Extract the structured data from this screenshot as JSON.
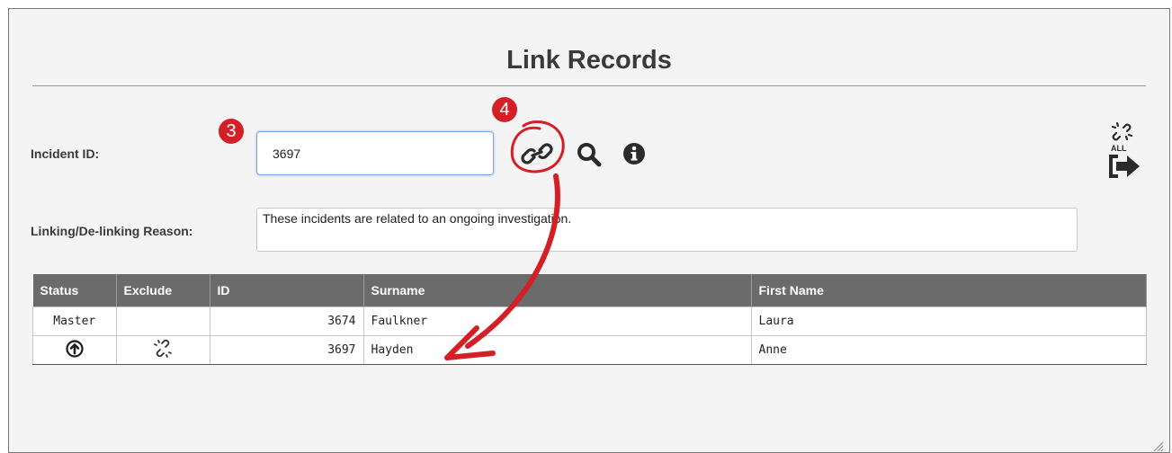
{
  "page": {
    "title": "Link Records"
  },
  "form": {
    "incident_id_label": "Incident ID:",
    "incident_id_value": "3697",
    "reason_label": "Linking/De-linking Reason:",
    "reason_value": "These incidents are related to an ongoing investigation."
  },
  "annotations": {
    "step_3": "3",
    "step_4": "4",
    "color": "#d51f26"
  },
  "icons": {
    "link": "link-icon",
    "search": "search-icon",
    "info": "info-icon",
    "unlink_all": "unlink-all-icon",
    "unlink_all_text": "ALL",
    "status_up": "arrow-up-circle-icon",
    "exclude": "broken-link-icon"
  },
  "table": {
    "columns": [
      "Status",
      "Exclude",
      "ID",
      "Surname",
      "First Name"
    ],
    "rows": [
      {
        "status": "Master",
        "exclude": "",
        "id": "3674",
        "surname": "Faulkner",
        "first_name": "Laura"
      },
      {
        "status": "",
        "exclude": "",
        "id": "3697",
        "surname": "Hayden",
        "first_name": "Anne"
      }
    ]
  },
  "colors": {
    "header_bg": "#6b6b6b",
    "panel_bg": "#f4f4f4",
    "accent": "#d51f26"
  }
}
